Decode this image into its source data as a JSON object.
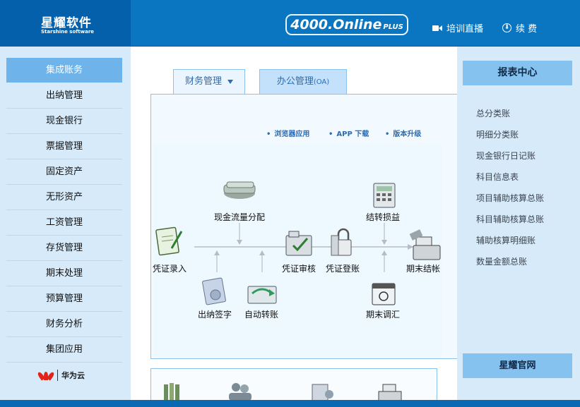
{
  "header": {
    "brand_name": "星耀软件",
    "brand_en": "Starshine software",
    "product": "4000.Online",
    "product_suffix": "PLUS",
    "live_label": "培训直播",
    "renew_label": "续 费",
    "live_icon": "video-camera-icon",
    "renew_icon": "renew-circle-icon"
  },
  "left_nav": {
    "active": "集成账务",
    "items": [
      "出纳管理",
      "现金银行",
      "票据管理",
      "固定资产",
      "无形资产",
      "工资管理",
      "存货管理",
      "期末处理",
      "预算管理",
      "财务分析",
      "集团应用"
    ],
    "partner": "华为云"
  },
  "tabs": {
    "finance": "财务管理",
    "office": "办公管理",
    "office_suffix": "(OA)"
  },
  "sublinks": {
    "browser": "浏览器应用",
    "app": "APP 下载",
    "upgrade": "版本升级"
  },
  "flow": {
    "voucher_entry": "凭证录入",
    "cashflow": "现金流量分配",
    "cashier_sign": "出纳签字",
    "auto_transfer": "自动转账",
    "voucher_audit": "凭证审核",
    "voucher_post": "凭证登账",
    "carry_pl": "结转损益",
    "period_adjust": "期末调汇",
    "period_close": "期末结帐"
  },
  "right": {
    "title": "报表中心",
    "links": [
      "总分类账",
      "明细分类账",
      "现金银行日记账",
      "科目信息表",
      "项目辅助核算总账",
      "科目辅助核算总账",
      "辅助核算明细账",
      "数量金额总账"
    ],
    "footer": "星耀官网"
  },
  "colors": {
    "header_bg": "#0a75c0",
    "sidebar_bg": "#d6eafa",
    "accent": "#6eb4eb",
    "link": "#2a6cb5"
  }
}
